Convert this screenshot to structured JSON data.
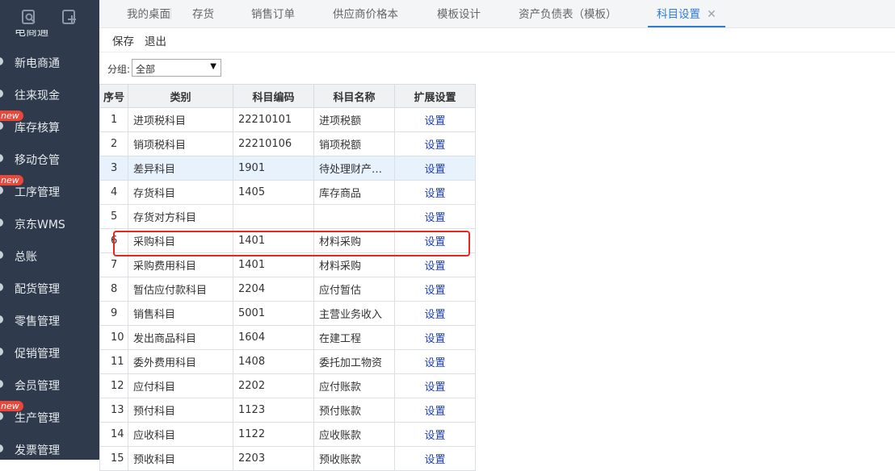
{
  "sidebar": {
    "partial_label": "电商通",
    "items": [
      {
        "label": "新电商通",
        "new": false
      },
      {
        "label": "往来现金",
        "new": false
      },
      {
        "label": "库存核算",
        "new": true
      },
      {
        "label": "移动仓管",
        "new": false
      },
      {
        "label": "工序管理",
        "new": true
      },
      {
        "label": "京东WMS",
        "new": false
      },
      {
        "label": "总账",
        "new": false
      },
      {
        "label": "配货管理",
        "new": false
      },
      {
        "label": "零售管理",
        "new": false
      },
      {
        "label": "促销管理",
        "new": false
      },
      {
        "label": "会员管理",
        "new": false
      },
      {
        "label": "生产管理",
        "new": true
      },
      {
        "label": "发票管理",
        "new": false
      }
    ],
    "new_badge": "new",
    "top_icons": [
      "search-doc-icon",
      "add-doc-icon"
    ]
  },
  "tabs": [
    {
      "label": "我的桌面"
    },
    {
      "label": "存货"
    },
    {
      "label": "销售订单"
    },
    {
      "label": "供应商价格本"
    },
    {
      "label": "模板设计"
    },
    {
      "label": "资产负债表（模板）"
    },
    {
      "label": "科目设置",
      "active": true,
      "close": "✕"
    }
  ],
  "toolbar": {
    "save": "保存",
    "exit": "退出"
  },
  "filter": {
    "label": "分组:",
    "value": "全部",
    "arrow": "▼"
  },
  "table": {
    "headers": [
      "序号",
      "类别",
      "科目编码",
      "科目名称",
      "扩展设置"
    ],
    "rows": [
      {
        "no": "1",
        "category": "进项税科目",
        "code": "22210101",
        "name": "进项税额",
        "action": "设置"
      },
      {
        "no": "2",
        "category": "销项税科目",
        "code": "22210106",
        "name": "销项税额",
        "action": "设置"
      },
      {
        "no": "3",
        "category": "差异科目",
        "code": "1901",
        "name": "待处理财产…",
        "action": "设置",
        "selected": true
      },
      {
        "no": "4",
        "category": "存货科目",
        "code": "1405",
        "name": "库存商品",
        "action": "设置"
      },
      {
        "no": "5",
        "category": "存货对方科目",
        "code": "",
        "name": "",
        "action": "设置"
      },
      {
        "no": "6",
        "category": "采购科目",
        "code": "1401",
        "name": "材料采购",
        "action": "设置"
      },
      {
        "no": "7",
        "category": "采购费用科目",
        "code": "1401",
        "name": "材料采购",
        "action": "设置"
      },
      {
        "no": "8",
        "category": "暂估应付款科目",
        "code": "2204",
        "name": "应付暂估",
        "action": "设置"
      },
      {
        "no": "9",
        "category": "销售科目",
        "code": "5001",
        "name": "主营业务收入",
        "action": "设置"
      },
      {
        "no": "10",
        "category": "发出商品科目",
        "code": "1604",
        "name": "在建工程",
        "action": "设置"
      },
      {
        "no": "11",
        "category": "委外费用科目",
        "code": "1408",
        "name": "委托加工物资",
        "action": "设置"
      },
      {
        "no": "12",
        "category": "应付科目",
        "code": "2202",
        "name": "应付账款",
        "action": "设置"
      },
      {
        "no": "13",
        "category": "预付科目",
        "code": "1123",
        "name": "预付账款",
        "action": "设置"
      },
      {
        "no": "14",
        "category": "应收科目",
        "code": "1122",
        "name": "应收账款",
        "action": "设置"
      },
      {
        "no": "15",
        "category": "预收科目",
        "code": "2203",
        "name": "预收账款",
        "action": "设置"
      }
    ]
  },
  "colors": {
    "sidebar_bg": "#2f3b4c",
    "accent": "#2f7cd3",
    "link": "#1d3fb8",
    "highlight": "#e8261e",
    "new_badge": "#e8473a"
  }
}
